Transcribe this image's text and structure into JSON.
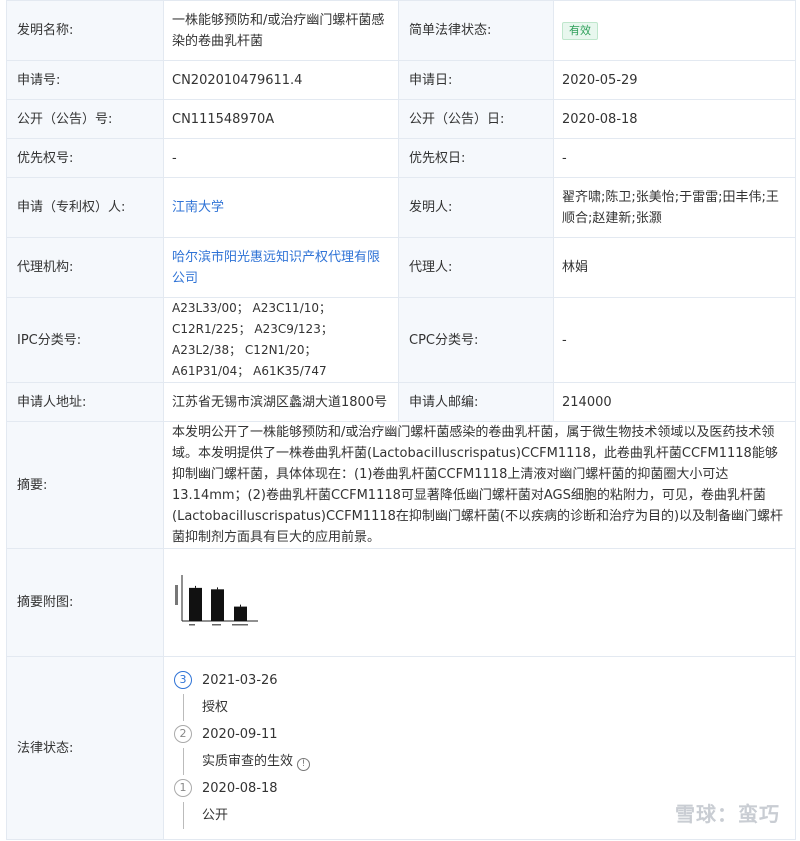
{
  "rows": {
    "invention_name": {
      "label": "发明名称:",
      "value": "一株能够预防和/或治疗幽门螺杆菌感染的卷曲乳杆菌"
    },
    "legal_status_simple": {
      "label": "简单法律状态:",
      "value": "有效"
    },
    "app_no": {
      "label": "申请号:",
      "value": "CN202010479611.4"
    },
    "app_date": {
      "label": "申请日:",
      "value": "2020-05-29"
    },
    "pub_no": {
      "label": "公开（公告）号:",
      "value": "CN111548970A"
    },
    "pub_date": {
      "label": "公开（公告）日:",
      "value": "2020-08-18"
    },
    "priority_no": {
      "label": "优先权号:",
      "value": "-"
    },
    "priority_date": {
      "label": "优先权日:",
      "value": "-"
    },
    "applicant": {
      "label": "申请（专利权）人:",
      "value": "江南大学"
    },
    "inventors": {
      "label": "发明人:",
      "value": "翟齐啸;陈卫;张美怡;于雷雷;田丰伟;王顺合;赵建新;张灏"
    },
    "agency": {
      "label": "代理机构:",
      "value": "哈尔滨市阳光惠远知识产权代理有限公司"
    },
    "agent": {
      "label": "代理人:",
      "value": "林娟"
    },
    "ipc": {
      "label": "IPC分类号:",
      "value": "A23L33/00； A23C11/10； C12R1/225； A23C9/123； A23L2/38； C12N1/20； A61P31/04； A61K35/747"
    },
    "cpc": {
      "label": "CPC分类号:",
      "value": "-"
    },
    "address": {
      "label": "申请人地址:",
      "value": "江苏省无锡市滨湖区蠡湖大道1800号"
    },
    "postcode": {
      "label": "申请人邮编:",
      "value": "214000"
    },
    "abstract": {
      "label": "摘要:",
      "value": "本发明公开了一株能够预防和/或治疗幽门螺杆菌感染的卷曲乳杆菌，属于微生物技术领域以及医药技术领域。本发明提供了一株卷曲乳杆菌(Lactobacilluscrispatus)CCFM1118，此卷曲乳杆菌CCFM1118能够抑制幽门螺杆菌，具体体现在：(1)卷曲乳杆菌CCFM1118上清液对幽门螺杆菌的抑菌圈大小可达13.14mm；(2)卷曲乳杆菌CCFM1118可显著降低幽门螺杆菌对AGS细胞的粘附力，可见，卷曲乳杆菌(Lactobacilluscrispatus)CCFM1118在抑制幽门螺杆菌(不以疾病的诊断和治疗为目的)以及制备幽门螺杆菌抑制剂方面具有巨大的应用前景。"
    },
    "abstract_figure": {
      "label": "摘要附图:"
    },
    "legal_status": {
      "label": "法律状态:"
    }
  },
  "figure": {
    "values": [
      0.92,
      0.88,
      0.4
    ]
  },
  "timeline": [
    {
      "num": "3",
      "date": "2021-03-26",
      "text": "授权"
    },
    {
      "num": "2",
      "date": "2020-09-11",
      "text": "实质审查的生效"
    },
    {
      "num": "1",
      "date": "2020-08-18",
      "text": "公开"
    }
  ],
  "watermark": "雪球：蛮巧"
}
